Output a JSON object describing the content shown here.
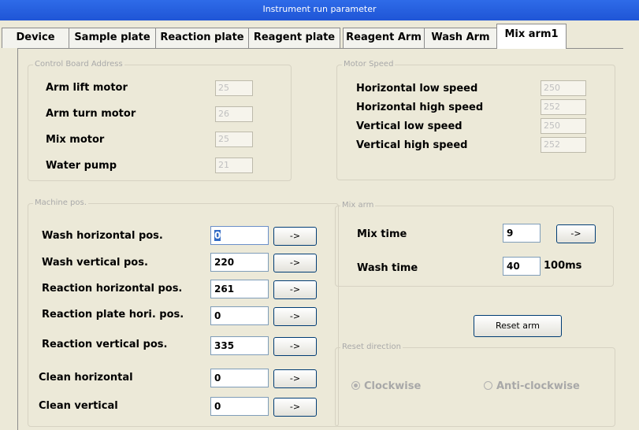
{
  "window": {
    "title": "Instrument run parameter"
  },
  "tabs": [
    {
      "label": "Device"
    },
    {
      "label": "Sample plate"
    },
    {
      "label": "Reaction plate"
    },
    {
      "label": "Reagent plate"
    },
    {
      "label": "Reagent Arm"
    },
    {
      "label": "Wash Arm"
    },
    {
      "label": "Mix arm1"
    }
  ],
  "active_tab": "Mix arm1",
  "control_board": {
    "legend": "Control Board Address",
    "rows": [
      {
        "label": "Arm lift motor",
        "value": "25"
      },
      {
        "label": "Arm turn  motor",
        "value": "26"
      },
      {
        "label": "Mix motor",
        "value": "25"
      },
      {
        "label": "Water pump",
        "value": "21"
      }
    ]
  },
  "motor_speed": {
    "legend": "Motor Speed",
    "rows": [
      {
        "label": "Horizontal low speed",
        "value": "250"
      },
      {
        "label": "Horizontal high speed",
        "value": "252"
      },
      {
        "label": "Vertical low speed",
        "value": "250"
      },
      {
        "label": "Vertical high speed",
        "value": "252"
      }
    ]
  },
  "machine_pos": {
    "legend": "Machine pos.",
    "button_label": "->",
    "rows": [
      {
        "label": "Wash horizontal pos.",
        "value": "0"
      },
      {
        "label": "Wash vertical pos.",
        "value": "220"
      },
      {
        "label": "Reaction horizontal pos.",
        "value": "261"
      },
      {
        "label": "Reaction plate hori. pos.",
        "value": "0"
      },
      {
        "label": "Reaction vertical pos.",
        "value": "335"
      },
      {
        "label": "Clean horizontal",
        "value": "0"
      },
      {
        "label": "Clean vertical",
        "value": "0"
      }
    ]
  },
  "mix_arm": {
    "legend": "Mix arm",
    "mix_time_label": "Mix time",
    "mix_time_value": "9",
    "mix_time_button": "->",
    "wash_time_label": "Wash time",
    "wash_time_value": "40",
    "wash_time_unit": "100ms"
  },
  "reset_arm_button": "Reset arm",
  "reset_direction": {
    "legend": "Reset direction",
    "options": [
      {
        "label": "Clockwise",
        "selected": true
      },
      {
        "label": "Anti-clockwise",
        "selected": false
      }
    ]
  }
}
